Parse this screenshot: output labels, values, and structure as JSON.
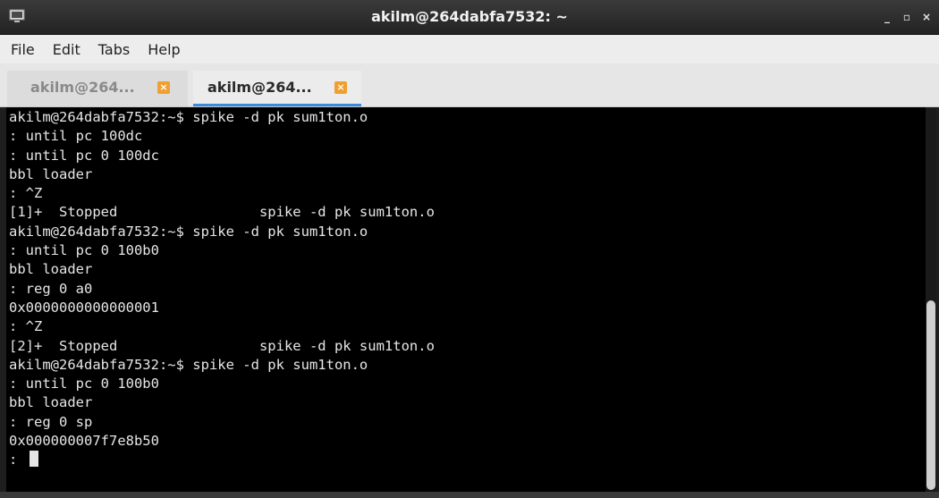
{
  "window": {
    "title": "akilm@264dabfa7532: ~",
    "icon": "terminal-icon",
    "controls": {
      "minimize": "_",
      "maximize": "▫",
      "close": "×"
    }
  },
  "menu": {
    "items": [
      "File",
      "Edit",
      "Tabs",
      "Help"
    ]
  },
  "tabs": [
    {
      "label": "akilm@264...",
      "active": false,
      "close_icon": "close-icon"
    },
    {
      "label": "akilm@264...",
      "active": true,
      "close_icon": "close-icon"
    }
  ],
  "terminal": {
    "lines": [
      "akilm@264dabfa7532:~$ spike -d pk sum1ton.o",
      ": until pc 100dc",
      ": until pc 0 100dc",
      "bbl loader",
      ": ^Z",
      "[1]+  Stopped                 spike -d pk sum1ton.o",
      "akilm@264dabfa7532:~$ spike -d pk sum1ton.o",
      ": until pc 0 100b0",
      "bbl loader",
      ": reg 0 a0",
      "0x0000000000000001",
      ": ^Z",
      "[2]+  Stopped                 spike -d pk sum1ton.o",
      "akilm@264dabfa7532:~$ spike -d pk sum1ton.o",
      ": until pc 0 100b0",
      "bbl loader",
      ": reg 0 sp",
      "0x000000007f7e8b50",
      ": "
    ]
  },
  "colors": {
    "terminal_bg": "#000000",
    "terminal_fg": "#e6e6e6",
    "active_tab_underline": "#3c8bd9",
    "tab_close": "#f0a030"
  }
}
